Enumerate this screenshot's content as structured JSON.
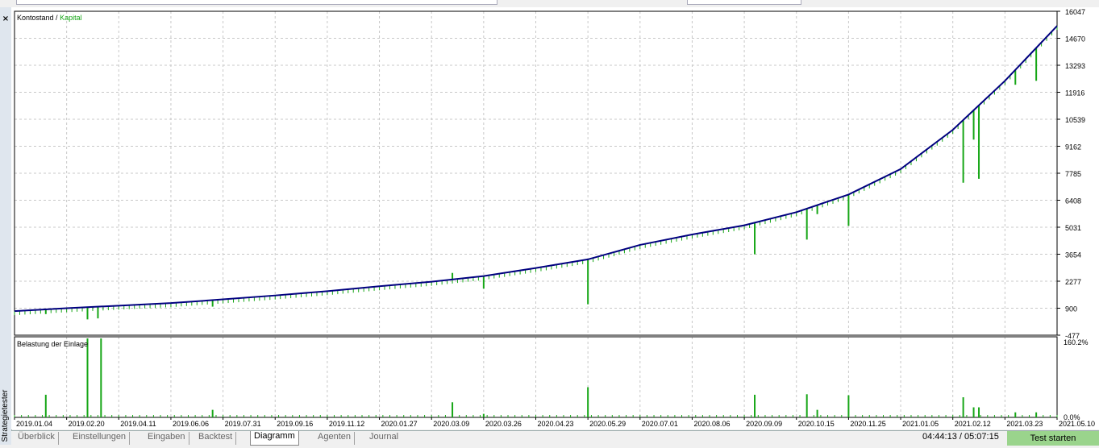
{
  "window": {
    "close_glyph": "×",
    "side_label": "Strategietester"
  },
  "colors": {
    "balance": "#00007f",
    "equity": "#16a616",
    "load": "#16a616",
    "grid": "#c8c8c8",
    "run_button": "#9ad48c"
  },
  "top_chart": {
    "legend_balance": "Kontostand",
    "legend_sep": " / ",
    "legend_equity": "Kapital"
  },
  "bottom_chart": {
    "title": "Belastung der Einlage"
  },
  "chart_data": [
    {
      "type": "line",
      "title": "Kontostand / Kapital",
      "series": [
        {
          "name": "Kontostand",
          "x_frac": [
            0,
            0.05,
            0.1,
            0.15,
            0.2,
            0.25,
            0.3,
            0.35,
            0.4,
            0.45,
            0.5,
            0.55,
            0.6,
            0.65,
            0.7,
            0.75,
            0.8,
            0.85,
            0.9,
            0.95,
            1.0
          ],
          "values": [
            750,
            900,
            1030,
            1160,
            1350,
            1550,
            1770,
            2020,
            2250,
            2540,
            2950,
            3390,
            4130,
            4660,
            5130,
            5800,
            6700,
            8000,
            10000,
            12500,
            15300
          ]
        },
        {
          "name": "Kapital",
          "values_note_dips": [
            [
              0.03,
              600
            ],
            [
              0.07,
              330
            ],
            [
              0.08,
              380
            ],
            [
              0.19,
              980
            ],
            [
              0.42,
              2700
            ],
            [
              0.45,
              1900
            ],
            [
              0.55,
              1100
            ],
            [
              0.71,
              3650
            ],
            [
              0.76,
              4400
            ],
            [
              0.77,
              5700
            ],
            [
              0.8,
              5100
            ],
            [
              0.91,
              7300
            ],
            [
              0.92,
              9500
            ],
            [
              0.925,
              7500
            ],
            [
              0.96,
              12300
            ],
            [
              0.98,
              12500
            ]
          ]
        }
      ],
      "xlim_labels": [
        "2019.01.04",
        "2021.05.10"
      ],
      "ylim": [
        -477,
        16047
      ],
      "y_ticks": [
        "16047",
        "14670",
        "13293",
        "11916",
        "10539",
        "9162",
        "7785",
        "6408",
        "5031",
        "3654",
        "2277",
        "900",
        "-477"
      ],
      "grid": true,
      "legend": "top-left"
    },
    {
      "type": "bar",
      "title": "Belastung der Einlage",
      "ylim": [
        0,
        160.2
      ],
      "y_ticks": [
        "160.2%",
        "0.0%"
      ],
      "spikes": [
        [
          0.03,
          45
        ],
        [
          0.07,
          157
        ],
        [
          0.083,
          157
        ],
        [
          0.19,
          15
        ],
        [
          0.42,
          30
        ],
        [
          0.45,
          7
        ],
        [
          0.55,
          60
        ],
        [
          0.71,
          45
        ],
        [
          0.76,
          46
        ],
        [
          0.77,
          15
        ],
        [
          0.8,
          44
        ],
        [
          0.91,
          40
        ],
        [
          0.92,
          20
        ],
        [
          0.925,
          20
        ],
        [
          0.96,
          10
        ],
        [
          0.98,
          10
        ]
      ]
    }
  ],
  "x_axis": {
    "labels": [
      "2019.01.04",
      "2019.02.20",
      "2019.04.11",
      "2019.06.06",
      "2019.07.31",
      "2019.09.16",
      "2019.11.12",
      "2020.01.27",
      "2020.03.09",
      "2020.03.26",
      "2020.04.23",
      "2020.05.29",
      "2020.07.01",
      "2020.08.06",
      "2020.09.09",
      "2020.10.15",
      "2020.11.25",
      "2021.01.05",
      "2021.02.12",
      "2021.03.23",
      "2021.05.10"
    ]
  },
  "tabs": [
    {
      "label": "Überblick"
    },
    {
      "label": "Einstellungen"
    },
    {
      "label": "Eingaben"
    },
    {
      "label": "Backtest"
    },
    {
      "label": "Diagramm"
    },
    {
      "label": "Agenten"
    },
    {
      "label": "Journal"
    }
  ],
  "status": {
    "time": "04:44:13 / 05:07:15",
    "run_button": "Test starten"
  }
}
